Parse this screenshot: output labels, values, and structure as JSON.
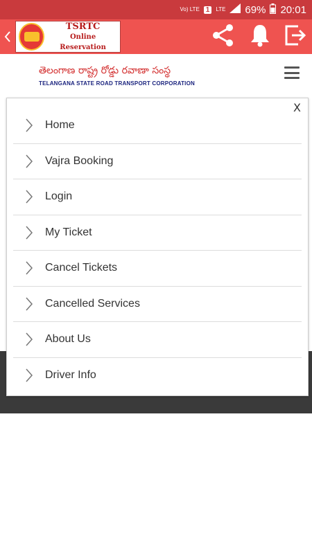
{
  "status_bar": {
    "volte": "Vo) LTE",
    "sim": "1",
    "lte": "LTE",
    "battery": "69%",
    "time": "20:01"
  },
  "app_bar": {
    "logo_title": "TSRTC",
    "logo_subtitle": "Online Reservation",
    "logo_badge_text": "TSRTC Online Reservation",
    "icons": [
      "back-icon",
      "share-icon",
      "bell-icon",
      "logout-icon"
    ]
  },
  "header": {
    "telugu_name": "తెలంగాణ రాష్ట్ర రోడ్డు రవాణా సంస్థ",
    "english_name": "TELANGANA STATE ROAD TRANSPORT CORPORATION"
  },
  "menu": {
    "close_label": "X",
    "items": [
      {
        "label": "Home"
      },
      {
        "label": "Vajra Booking"
      },
      {
        "label": "Login"
      },
      {
        "label": "My Ticket"
      },
      {
        "label": "Cancel Tickets"
      },
      {
        "label": "Cancelled Services"
      },
      {
        "label": "About Us"
      },
      {
        "label": "Driver Info"
      }
    ]
  },
  "colors": {
    "status_bar": "#c93a3d",
    "app_bar": "#ef5350",
    "dark_band": "#3a3a3a"
  }
}
